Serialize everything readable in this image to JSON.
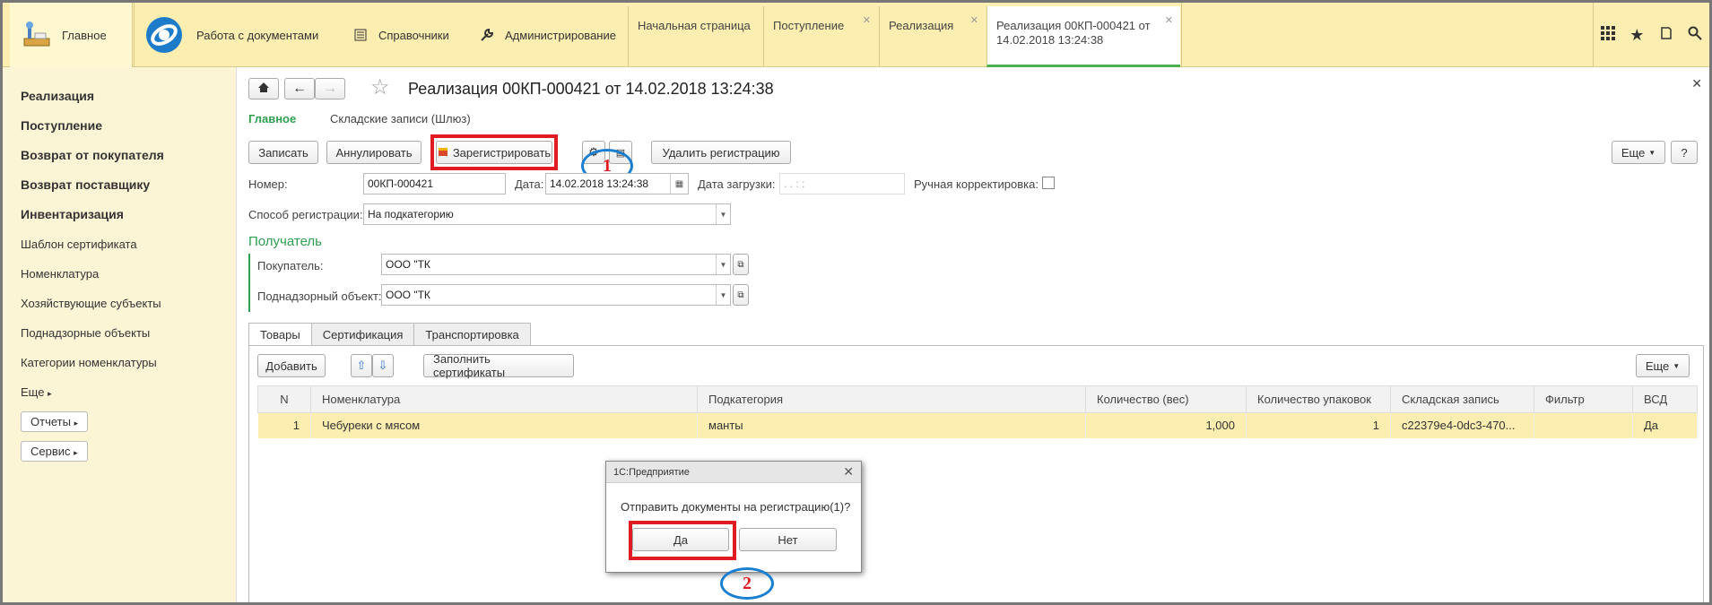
{
  "sections": {
    "home": "Главное",
    "docs": "Работа с документами",
    "refs": "Справочники",
    "admin": "Администрирование"
  },
  "open_tabs": [
    {
      "label": "Начальная страница"
    },
    {
      "label": "Поступление"
    },
    {
      "label": "Реализация"
    },
    {
      "label_line1": "Реализация 00КП-000421 от",
      "label_line2": "14.02.2018 13:24:38"
    }
  ],
  "sidebar": {
    "items": [
      "Реализация",
      "Поступление",
      "Возврат от покупателя",
      "Возврат поставщику",
      "Инвентаризация",
      "Шаблон сертификата",
      "Номенклатура",
      "Хозяйствующие субъекты",
      "Поднадзорные объекты",
      "Категории номенклатуры"
    ],
    "more": "Еще",
    "reports": "Отчеты",
    "service": "Сервис"
  },
  "doc": {
    "title": "Реализация 00КП-000421 от 14.02.2018 13:24:38",
    "nav_main": "Главное",
    "nav_records": "Складские записи (Шлюз)"
  },
  "toolbar": {
    "save": "Записать",
    "cancel": "Аннулировать",
    "register": "Зарегистрировать",
    "delete_reg": "Удалить регистрацию",
    "more": "Еще",
    "help": "?"
  },
  "form": {
    "number_label": "Номер:",
    "number_value": "00КП-000421",
    "date_label": "Дата:",
    "date_value": "14.02.2018 13:24:38",
    "load_date_label": "Дата загрузки:",
    "load_date_value": " .  .       :  :  ",
    "manual_label": "Ручная корректировка:",
    "method_label": "Способ регистрации:",
    "method_value": "На подкатегорию",
    "recipient_header": "Получатель",
    "buyer_label": "Покупатель:",
    "buyer_value": "ООО \"ТК",
    "object_label": "Поднадзорный объект:",
    "object_value": "ООО \"ТК"
  },
  "content_tabs": [
    "Товары",
    "Сертификация",
    "Транспортировка"
  ],
  "table_toolbar": {
    "add": "Добавить",
    "fill": "Заполнить сертификаты",
    "more": "Еще"
  },
  "table": {
    "columns": [
      "N",
      "Номенклатура",
      "Подкатегория",
      "Количество (вес)",
      "Количество упаковок",
      "Складская запись",
      "Фильтр",
      "ВСД"
    ],
    "rows": [
      [
        "1",
        "Чебуреки с мясом",
        "манты",
        "1,000",
        "1",
        "c22379e4-0dc3-470...",
        "",
        "Да"
      ]
    ]
  },
  "dialog": {
    "title": "1С:Предприятие",
    "message": "Отправить документы на регистрацию(1)?",
    "yes": "Да",
    "no": "Нет"
  },
  "callouts": {
    "one": "1",
    "two": "2"
  },
  "colors": {
    "topbar": "#fbeeb0",
    "sidebar": "#fbf5d6",
    "green": "#2e9e4f",
    "highlight_red": "#e01b22",
    "callout_blue": "#1a7fd0"
  }
}
